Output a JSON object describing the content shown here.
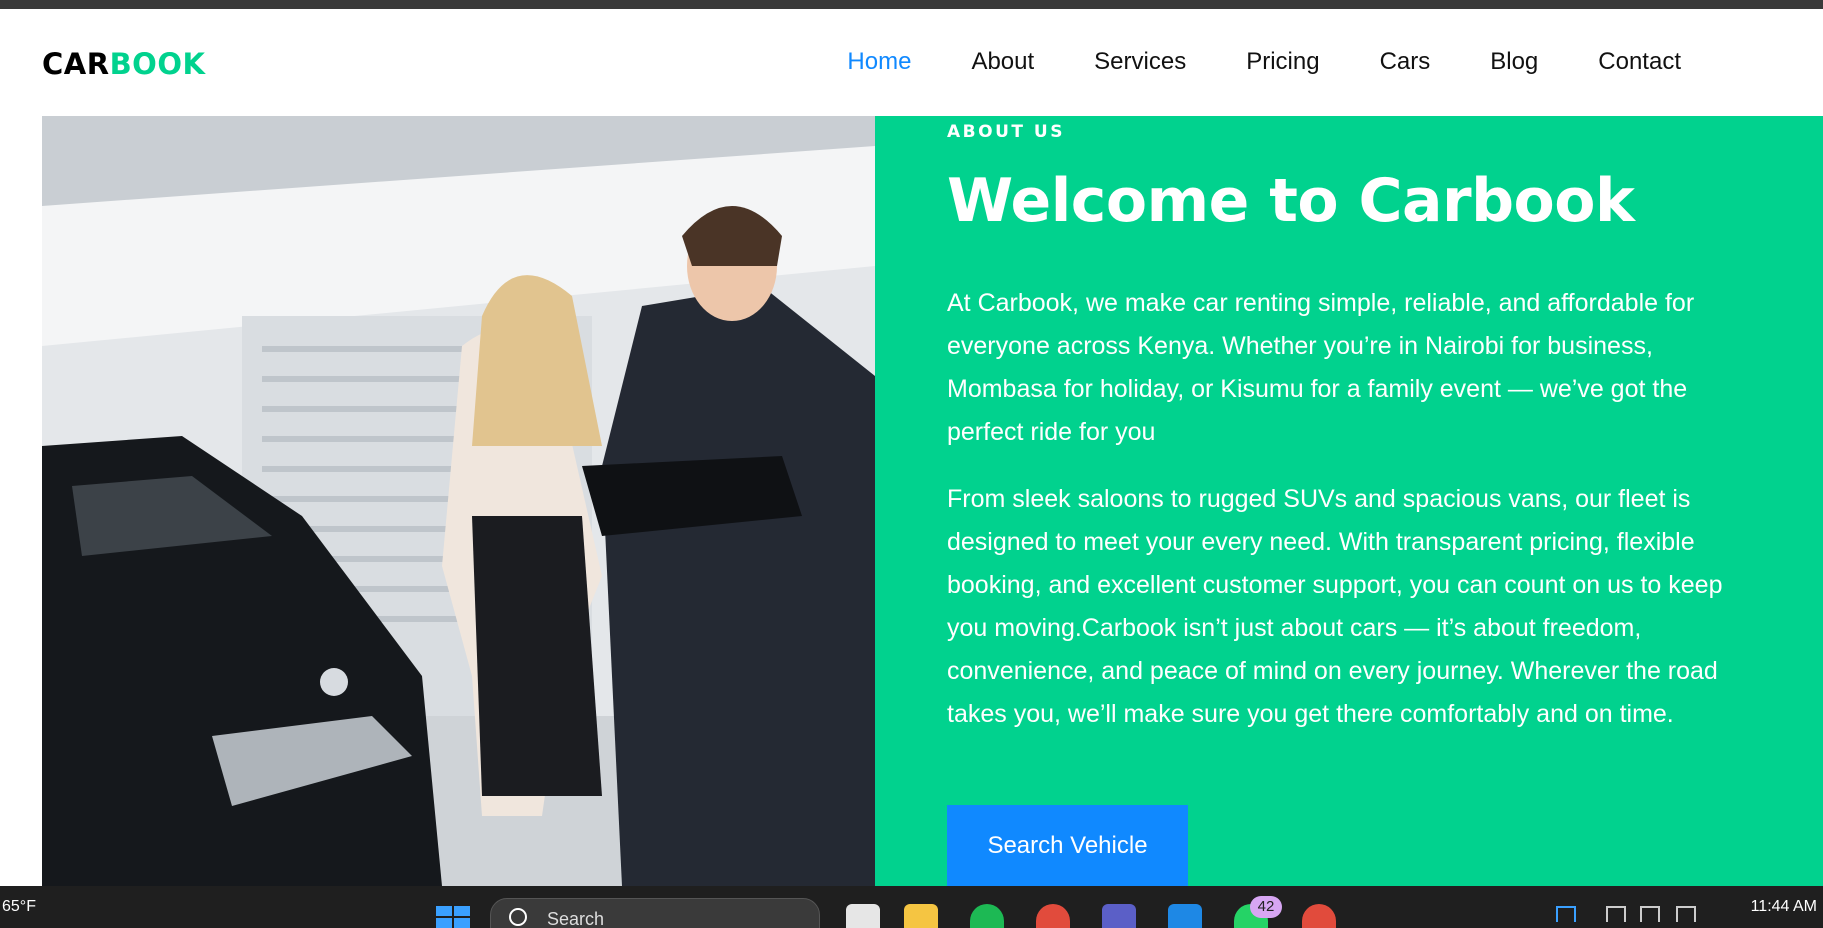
{
  "brand": {
    "part1": "CAR",
    "part2": "BOOK"
  },
  "nav": {
    "items": [
      {
        "label": "Home",
        "active": true
      },
      {
        "label": "About"
      },
      {
        "label": "Services"
      },
      {
        "label": "Pricing"
      },
      {
        "label": "Cars"
      },
      {
        "label": "Blog"
      },
      {
        "label": "Contact"
      }
    ]
  },
  "about": {
    "eyebrow": "ABOUT US",
    "title": "Welcome to Carbook",
    "paragraph1": "At Carbook, we make car renting simple, reliable, and affordable for everyone across Kenya. Whether you’re in Nairobi for business, Mombasa for holiday, or Kisumu for a family event — we’ve got the perfect ride for you",
    "paragraph2": "From sleek saloons to rugged SUVs and spacious vans, our fleet is designed to meet your every need. With transparent pricing, flexible booking, and excellent customer support, you can count on us to keep you moving.Carbook isn’t just about cars — it’s about freedom, convenience, and peace of mind on every journey. Wherever the road takes you, we’ll make sure you get there comfortably and on time.",
    "cta": "Search Vehicle"
  },
  "taskbar": {
    "weather": "65°F",
    "search_placeholder": "Search",
    "badge_count": "42",
    "clock": "11:44 AM"
  },
  "colors": {
    "accent": "#01d28e",
    "primary": "#1089ff",
    "text": "#111111"
  }
}
